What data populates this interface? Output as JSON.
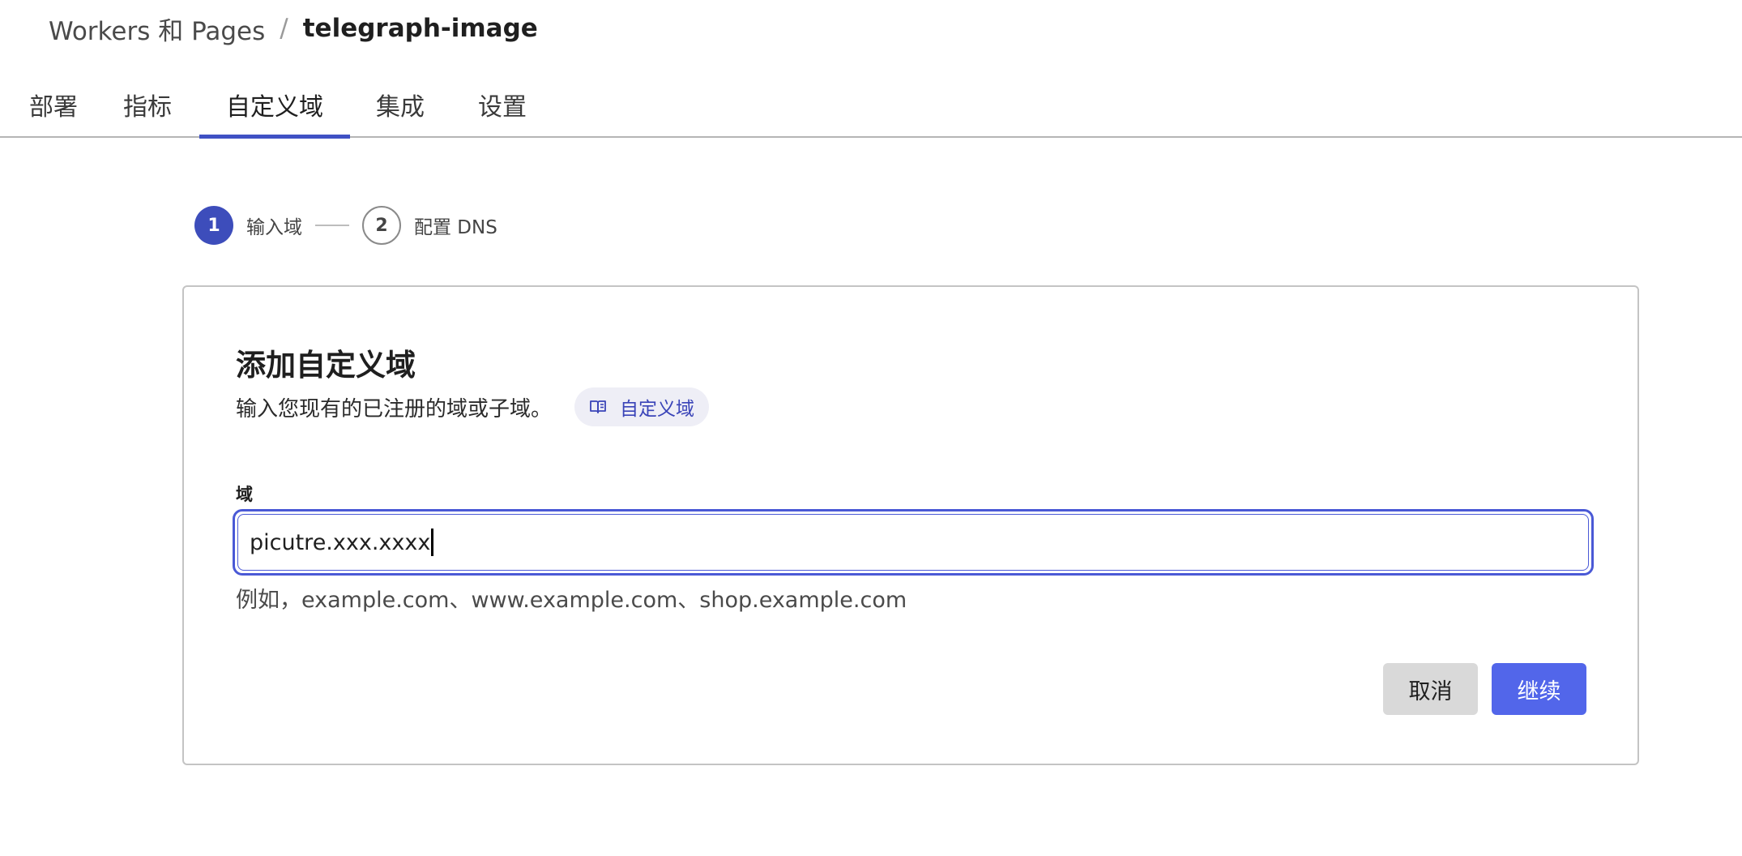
{
  "breadcrumb": {
    "parent": "Workers 和 Pages",
    "separator": "/",
    "current": "telegraph-image"
  },
  "tabs": [
    {
      "label": "部署",
      "active": false
    },
    {
      "label": "指标",
      "active": false
    },
    {
      "label": "自定义域",
      "active": true
    },
    {
      "label": "集成",
      "active": false
    },
    {
      "label": "设置",
      "active": false
    }
  ],
  "stepper": {
    "steps": [
      {
        "number": "1",
        "label": "输入域",
        "state": "active"
      },
      {
        "number": "2",
        "label": "配置 DNS",
        "state": "pending"
      }
    ]
  },
  "card": {
    "title": "添加自定义域",
    "description": "输入您现有的已注册的域或子域。",
    "doc_link_label": "自定义域",
    "doc_link_icon": "book-icon",
    "field_label": "域",
    "input_value": "picutre.xxx.xxxx",
    "hint": "例如，example.com、www.example.com、shop.example.com",
    "cancel_label": "取消",
    "continue_label": "继续"
  },
  "colors": {
    "accent": "#3d4dbb",
    "primary_button": "#5266ea",
    "focus_border": "#4a59d6",
    "secondary_button": "#d9d9d9"
  }
}
